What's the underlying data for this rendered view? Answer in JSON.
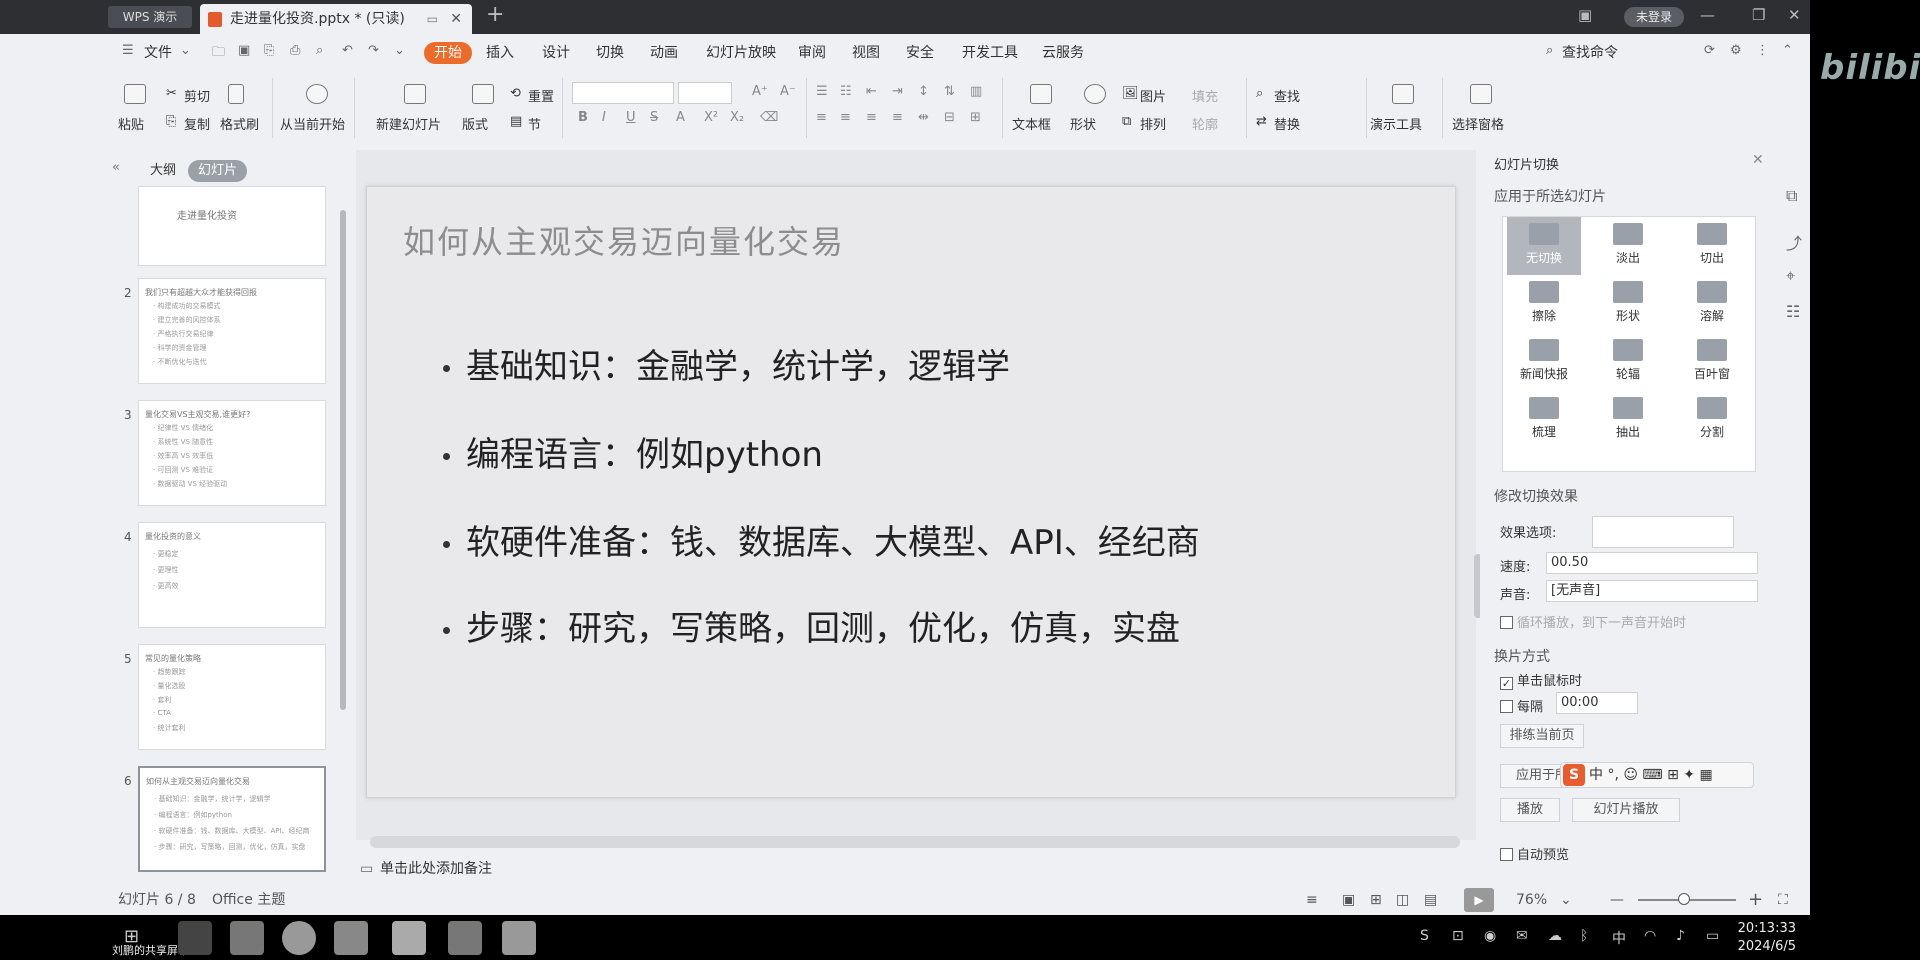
{
  "window": {
    "app_logo": "WPS 演示",
    "doc_tab": "走进量化投资.pptx * (只读)",
    "login_button": "未登录"
  },
  "menu": {
    "file": "文件",
    "items": [
      "开始",
      "插入",
      "设计",
      "切换",
      "动画",
      "幻灯片放映",
      "审阅",
      "视图",
      "安全",
      "开发工具",
      "云服务"
    ],
    "search": "查找命令"
  },
  "ribbon": {
    "paste": "粘贴",
    "cut": "剪切",
    "copy": "复制",
    "format_painter": "格式刷",
    "from_current": "从当前开始",
    "new_slide": "新建幻灯片",
    "layout": "版式",
    "reset": "重置",
    "section": "节",
    "text_box": "文本框",
    "shape": "形状",
    "picture": "图片",
    "arrange": "排列",
    "fill": "填充",
    "outline": "轮廓",
    "find": "查找",
    "replace": "替换",
    "present_tools": "演示工具",
    "selection_pane": "选择窗格"
  },
  "left_panel": {
    "tab_outline": "大纲",
    "tab_slides": "幻灯片",
    "thumbs": [
      {
        "num": "",
        "title": "走进量化投资",
        "lines": []
      },
      {
        "num": "2",
        "title": "我们只有超越大众才能获得回报",
        "lines": [
          "· 构建成功的交易模式",
          "· 建立完善的风控体系",
          "· 严格执行交易纪律",
          "· 科学的资金管理",
          "· 不断优化与迭代"
        ]
      },
      {
        "num": "3",
        "title": "量化交易VS主观交易,谁更好?",
        "lines": [
          "· 纪律性 VS 情绪化",
          "· 系统性 VS 随意性",
          "· 效率高 VS 效率低",
          "· 可回测 VS 难验证",
          "· 数据驱动 VS 经验驱动"
        ]
      },
      {
        "num": "4",
        "title": "量化投资的意义",
        "lines": [
          "· 更稳定",
          "· 更理性",
          "· 更高效"
        ]
      },
      {
        "num": "5",
        "title": "常见的量化策略",
        "lines": [
          "· 趋势跟踪",
          "· 量化选股",
          "· 套利",
          "· CTA",
          "· 统计套利"
        ]
      },
      {
        "num": "6",
        "title": "如何从主观交易迈向量化交易",
        "lines": [
          "· 基础知识：金融学，统计学，逻辑学",
          "· 编程语言：例如python",
          "· 软硬件准备：钱、数据库、大模型、API、经纪商",
          "· 步骤：研究，写策略，回测，优化，仿真，实盘"
        ]
      }
    ]
  },
  "slide": {
    "title": "如何从主观交易迈向量化交易",
    "bullets": [
      "基础知识：金融学，统计学，逻辑学",
      "编程语言：例如python",
      "软硬件准备：钱、数据库、大模型、API、经纪商",
      "步骤：研究，写策略，回测，优化，仿真，实盘"
    ]
  },
  "notes_placeholder": "单击此处添加备注",
  "right_panel": {
    "title": "幻灯片切换",
    "apply_to_selected": "应用于所选幻灯片",
    "transitions": [
      "无切换",
      "淡出",
      "切出",
      "擦除",
      "形状",
      "溶解",
      "新闻快报",
      "轮辐",
      "百叶窗",
      "梳理",
      "抽出",
      "分割"
    ],
    "modify_effect": "修改切换效果",
    "effect_options_label": "效果选项:",
    "speed_label": "速度:",
    "speed_value": "00.50",
    "sound_label": "声音:",
    "sound_value": "[无声音]",
    "loop_play": "循环播放，到下一声音开始时",
    "advance_title": "换片方式",
    "on_click": "单击鼠标时",
    "every": "每隔",
    "every_value": "00:00",
    "rehearse": "排练当前页",
    "apply_all": "应用于所",
    "play": "播放",
    "slideshow": "幻灯片播放",
    "auto_preview": "自动预览"
  },
  "ime": {
    "lang": "中",
    "punct": "°,"
  },
  "status": {
    "slide_count": "幻灯片 6 / 8",
    "theme": "Office 主题",
    "zoom": "76%"
  },
  "taskbar": {
    "share_label": "刘鹏的共享屏幕",
    "time": "20:13:33",
    "date": "2024/6/5"
  },
  "watermark": "bilibili"
}
